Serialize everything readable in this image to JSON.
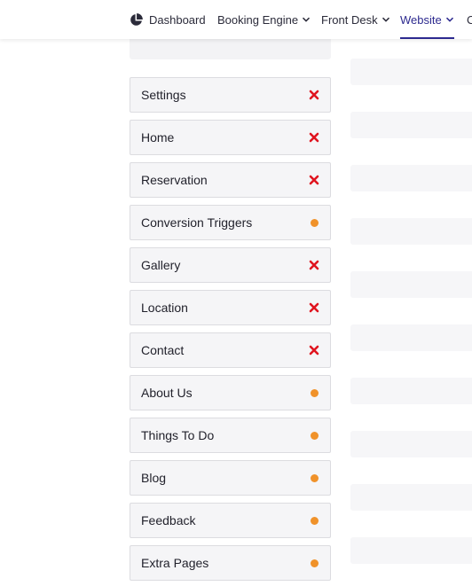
{
  "nav": {
    "items": [
      {
        "label": "Dashboard"
      },
      {
        "label": "Booking Engine"
      },
      {
        "label": "Front Desk"
      },
      {
        "label": "Website"
      },
      {
        "label": "C"
      }
    ]
  },
  "sections": [
    {
      "label": "Settings",
      "status": "error"
    },
    {
      "label": "Home",
      "status": "error"
    },
    {
      "label": "Reservation",
      "status": "error"
    },
    {
      "label": "Conversion Triggers",
      "status": "pending"
    },
    {
      "label": "Gallery",
      "status": "error"
    },
    {
      "label": "Location",
      "status": "error"
    },
    {
      "label": "Contact",
      "status": "error"
    },
    {
      "label": "About Us",
      "status": "pending"
    },
    {
      "label": "Things To Do",
      "status": "pending"
    },
    {
      "label": "Blog",
      "status": "pending"
    },
    {
      "label": "Feedback",
      "status": "pending"
    },
    {
      "label": "Extra Pages",
      "status": "pending"
    }
  ],
  "colors": {
    "accent": "#2d2a8f",
    "error": "#e0141f",
    "pending": "#f0922a"
  }
}
